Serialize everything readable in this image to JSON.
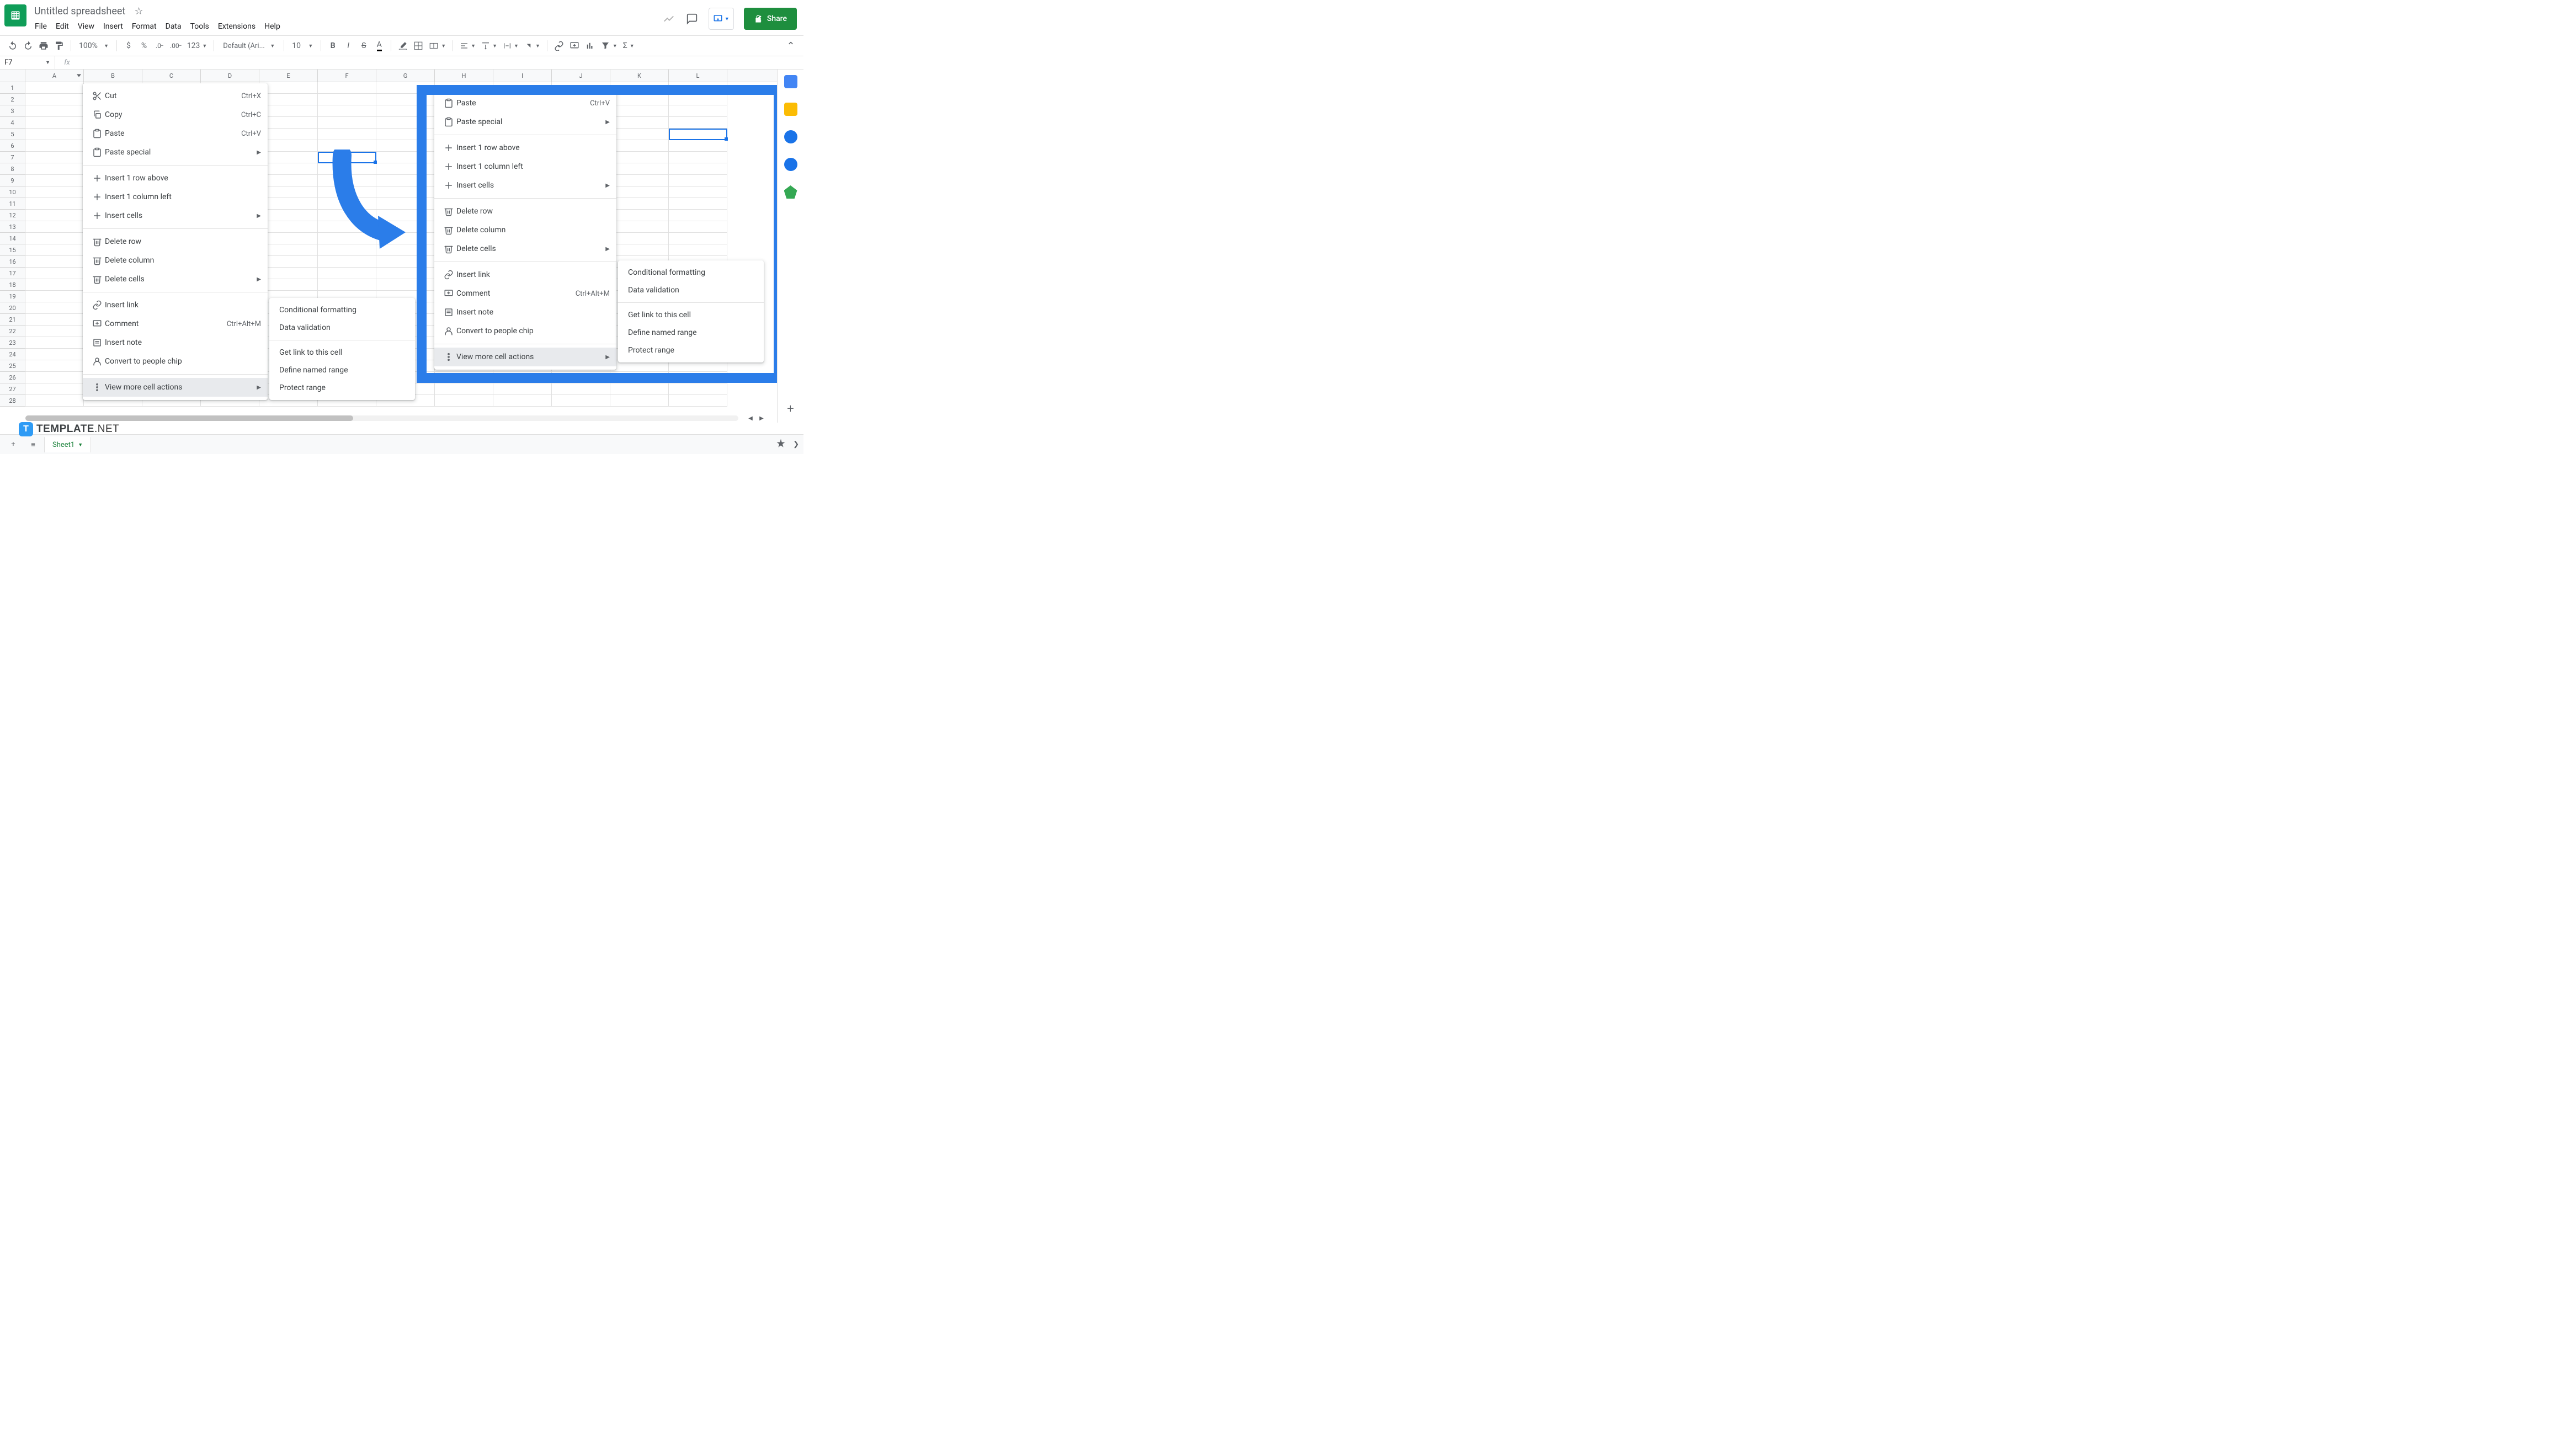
{
  "doc": {
    "title": "Untitled spreadsheet",
    "share_label": "Share"
  },
  "menubar": [
    "File",
    "Edit",
    "View",
    "Insert",
    "Format",
    "Data",
    "Tools",
    "Extensions",
    "Help"
  ],
  "toolbar": {
    "zoom": "100%",
    "font": "Default (Ari...",
    "fontsize": "10",
    "num_format": "123"
  },
  "namebox": {
    "value": "F7"
  },
  "formula": {
    "fx": "fx"
  },
  "columns": [
    "A",
    "B",
    "C",
    "D",
    "E",
    "F",
    "G",
    "H",
    "I",
    "J",
    "K",
    "L"
  ],
  "row_count": 28,
  "active_col_index": 0,
  "context_menu_left": {
    "groups": [
      [
        {
          "icon": "cut",
          "label": "Cut",
          "kb": "Ctrl+X"
        },
        {
          "icon": "copy",
          "label": "Copy",
          "kb": "Ctrl+C"
        },
        {
          "icon": "paste",
          "label": "Paste",
          "kb": "Ctrl+V"
        },
        {
          "icon": "paste",
          "label": "Paste special",
          "sub": true
        }
      ],
      [
        {
          "icon": "plus",
          "label": "Insert 1 row above"
        },
        {
          "icon": "plus",
          "label": "Insert 1 column left"
        },
        {
          "icon": "plus",
          "label": "Insert cells",
          "sub": true
        }
      ],
      [
        {
          "icon": "trash",
          "label": "Delete row"
        },
        {
          "icon": "trash",
          "label": "Delete column"
        },
        {
          "icon": "trash",
          "label": "Delete cells",
          "sub": true
        }
      ],
      [
        {
          "icon": "link",
          "label": "Insert link"
        },
        {
          "icon": "comment",
          "label": "Comment",
          "kb": "Ctrl+Alt+M"
        },
        {
          "icon": "note",
          "label": "Insert note"
        },
        {
          "icon": "people",
          "label": "Convert to people chip"
        }
      ],
      [
        {
          "icon": "more",
          "label": "View more cell actions",
          "sub": true,
          "highlighted": true
        }
      ]
    ]
  },
  "context_menu_right": {
    "groups": [
      [
        {
          "icon": "paste",
          "label": "Paste",
          "kb": "Ctrl+V"
        },
        {
          "icon": "paste",
          "label": "Paste special",
          "sub": true
        }
      ],
      [
        {
          "icon": "plus",
          "label": "Insert 1 row above"
        },
        {
          "icon": "plus",
          "label": "Insert 1 column left"
        },
        {
          "icon": "plus",
          "label": "Insert cells",
          "sub": true
        }
      ],
      [
        {
          "icon": "trash",
          "label": "Delete row"
        },
        {
          "icon": "trash",
          "label": "Delete column"
        },
        {
          "icon": "trash",
          "label": "Delete cells",
          "sub": true
        }
      ],
      [
        {
          "icon": "link",
          "label": "Insert link"
        },
        {
          "icon": "comment",
          "label": "Comment",
          "kb": "Ctrl+Alt+M"
        },
        {
          "icon": "note",
          "label": "Insert note"
        },
        {
          "icon": "people",
          "label": "Convert to people chip"
        }
      ],
      [
        {
          "icon": "more",
          "label": "View more cell actions",
          "sub": true,
          "highlighted": true
        }
      ]
    ]
  },
  "submenu": {
    "groups": [
      [
        {
          "label": "Conditional formatting"
        },
        {
          "label": "Data validation"
        }
      ],
      [
        {
          "label": "Get link to this cell"
        },
        {
          "label": "Define named range"
        },
        {
          "label": "Protect range"
        }
      ]
    ]
  },
  "sheet_tab": {
    "name": "Sheet1"
  },
  "watermark": {
    "brand_bold": "TEMPLATE",
    "brand_light": ".NET"
  }
}
